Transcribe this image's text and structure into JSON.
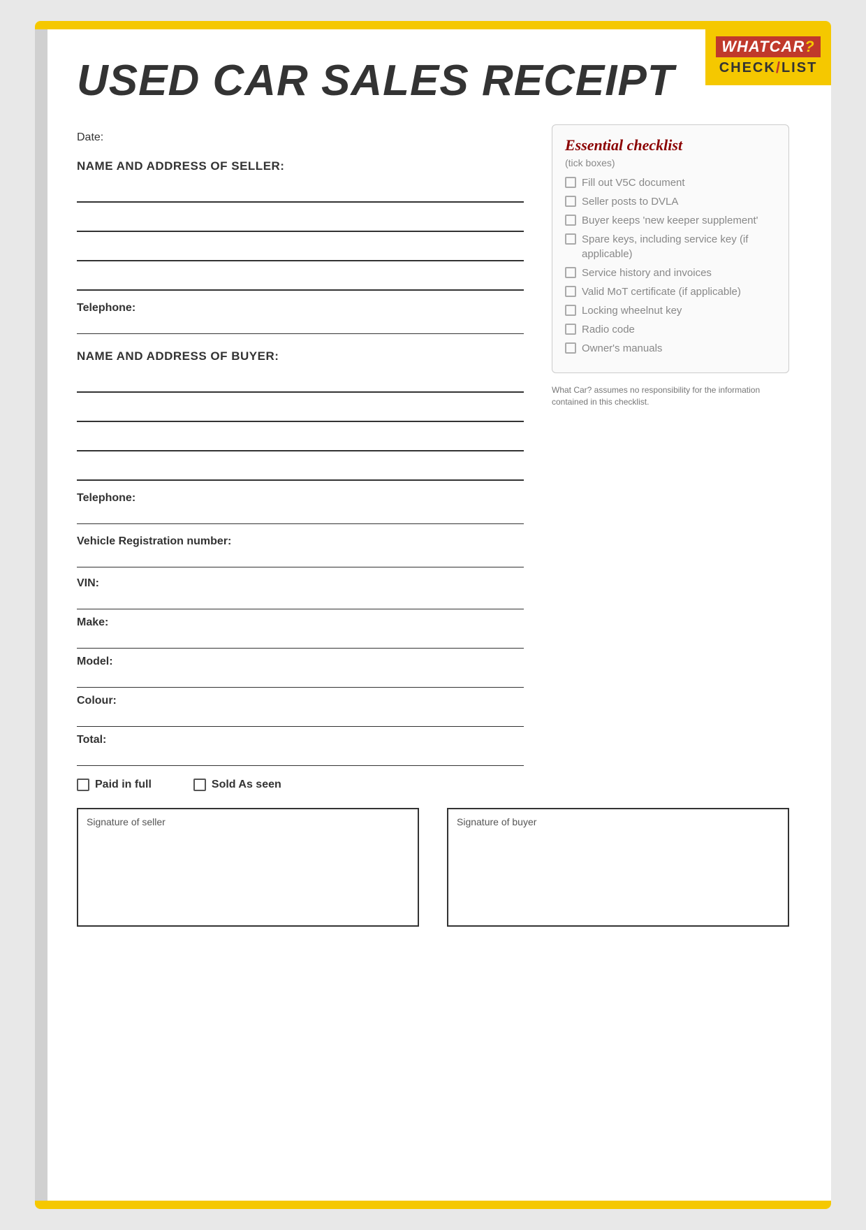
{
  "header": {
    "title": "USED CAR SALES RECEIPT"
  },
  "logo": {
    "whatcar": "WHATCAR?",
    "checklist": "CHECK/LIST"
  },
  "date_label": "Date:",
  "seller": {
    "label": "NAME AND ADDRESS OF SELLER:",
    "telephone_label": "Telephone:"
  },
  "buyer": {
    "label": "NAME AND ADDRESS OF BUYER:",
    "telephone_label": "Telephone:"
  },
  "vehicle": {
    "registration_label": "Vehicle Registration number:",
    "vin_label": "VIN:",
    "make_label": "Make:",
    "model_label": "Model:",
    "colour_label": "Colour:",
    "total_label": "Total:"
  },
  "payment": {
    "paid_in_full": "Paid in full",
    "sold_as_seen": "Sold As seen"
  },
  "signatures": {
    "seller_label": "Signature of seller",
    "buyer_label": "Signature of buyer"
  },
  "checklist": {
    "title": "Essential checklist",
    "subtitle": "(tick boxes)",
    "items": [
      "Fill out V5C document",
      "Seller posts to DVLA",
      "Buyer keeps 'new keeper supplement'",
      "Spare keys, including service key (if applicable)",
      "Service history and invoices",
      "Valid MoT certificate (if applicable)",
      "Locking wheelnut key",
      "Radio code",
      "Owner's manuals"
    ],
    "disclaimer": "What Car? assumes no responsibility for the information contained in this checklist."
  }
}
